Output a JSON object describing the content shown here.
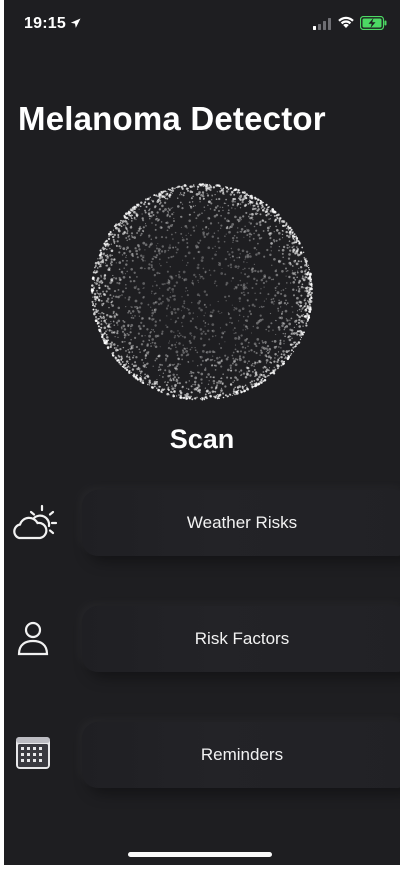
{
  "status_bar": {
    "time": "19:15",
    "icons": [
      "location-arrow-icon",
      "cellular-signal-icon",
      "wifi-icon",
      "battery-charging-icon"
    ],
    "battery_color": "#4cd964"
  },
  "header": {
    "title": "Melanoma Detector"
  },
  "scan": {
    "label": "Scan"
  },
  "menu": [
    {
      "label": "Weather Risks",
      "icon": "weather-sun-cloud-icon"
    },
    {
      "label": "Risk Factors",
      "icon": "person-icon"
    },
    {
      "label": "Reminders",
      "icon": "calendar-icon"
    }
  ],
  "theme": {
    "background": "#1e1e21",
    "text": "#ffffff"
  }
}
